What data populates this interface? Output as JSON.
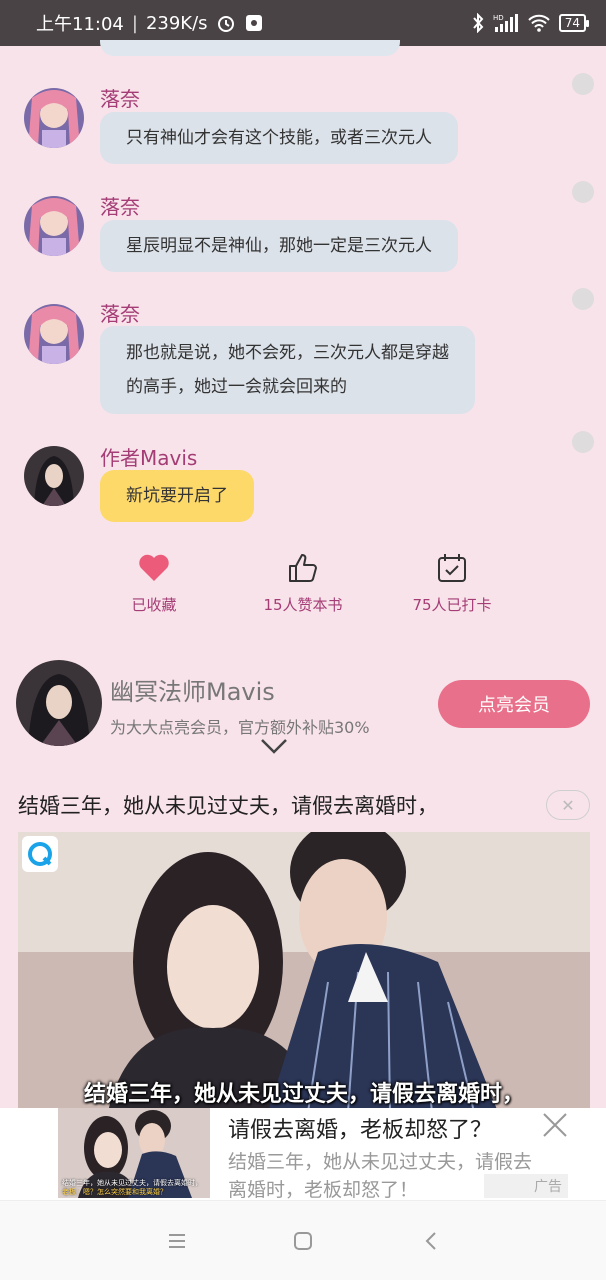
{
  "status_bar": {
    "time": "上午11:04",
    "speed": "239K/s",
    "battery": "74",
    "network": "HD"
  },
  "messages": [
    {
      "sender": "落奈",
      "text": "只有神仙才会有这个技能，或者三次元人"
    },
    {
      "sender": "落奈",
      "text": "星辰明显不是神仙，那她一定是三次元人"
    },
    {
      "sender": "落奈",
      "line1": "那也就是说，她不会死，三次元人都是穿越",
      "line2": "的高手，她过一会就会回来的"
    },
    {
      "sender": "作者Mavis",
      "text": "新坑要开启了"
    }
  ],
  "actions": {
    "favorite": "已收藏",
    "likes": "15人赞本书",
    "checkins": "75人已打卡"
  },
  "member": {
    "name": "幽冥法师Mavis",
    "subtitle": "为大大点亮会员，官方额外补贴30%",
    "button": "点亮会员"
  },
  "ad": {
    "title": "结婚三年，她从未见过丈夫，请假去离婚时，",
    "close": "✕",
    "caption": "结婚三年，她从未见过丈夫，请假去离婚时，"
  },
  "banner": {
    "title": "请假去离婚，老板却怒了？",
    "desc": "结婚三年，她从未见过丈夫，请假去离婚时，老板却怒了！",
    "ad_label": "广告",
    "thumb_caption": "结婚三年，她从未见过丈夫，请假去离婚时，",
    "thumb_caption2": "老板：嗯？怎么突然要和我离婚？"
  },
  "colors": {
    "background": "#f9e3ea",
    "accent": "#a43d76",
    "heart": "#ec5b7a",
    "member_button": "#e9708a",
    "author_bubble": "#fdd96a",
    "reader_bubble": "#dce2ea"
  },
  "icons": [
    "heart-icon",
    "thumbs-up-icon",
    "calendar-check-icon",
    "chevron-down-icon",
    "close-icon",
    "menu-icon",
    "home-square-icon",
    "back-icon"
  ]
}
